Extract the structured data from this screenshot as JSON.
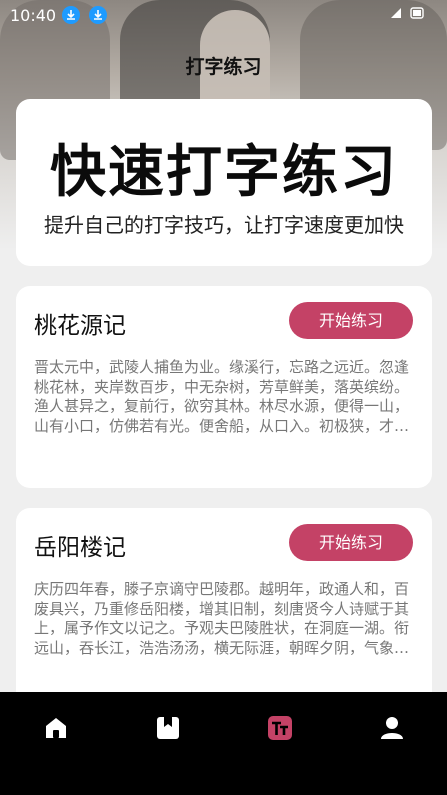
{
  "status_bar": {
    "time": "10:40",
    "icons": [
      "download-icon",
      "download-icon"
    ]
  },
  "page": {
    "title": "打字练习"
  },
  "hero": {
    "headline": "快速打字练习",
    "subtitle": "提升自己的打字技巧，让打字速度更加快"
  },
  "articles": [
    {
      "title": "桃花源记",
      "button": "开始练习",
      "preview": "晋太元中，武陵人捕鱼为业。缘溪行，忘路之远近。忽逢桃花林，夹岸数百步，中无杂树，芳草鲜美，落英缤纷。渔人甚异之，复前行，欲穷其林。林尽水源，便得一山，山有小口，仿佛若有光。便舍船，从口入。初极狭，才通人。复行数十步，豁然开朗。..."
    },
    {
      "title": "岳阳楼记",
      "button": "开始练习",
      "preview": "庆历四年春，滕子京谪守巴陵郡。越明年，政通人和，百废具兴，乃重修岳阳楼，增其旧制，刻唐贤今人诗赋于其上，属予作文以记之。予观夫巴陵胜状，在洞庭一湖。衔远山，吞长江，浩浩汤汤，横无际涯，朝晖夕阴，气象万千，此则岳阳楼之大观也，..."
    }
  ],
  "tabbar": {
    "tabs": [
      {
        "icon": "home-icon",
        "active": false
      },
      {
        "icon": "bookmark-icon",
        "active": false
      },
      {
        "icon": "typing-icon",
        "active": true
      },
      {
        "icon": "user-icon",
        "active": false
      }
    ],
    "accent": "#c44266"
  },
  "colors": {
    "button": "#c44266",
    "background": "#efefef"
  }
}
